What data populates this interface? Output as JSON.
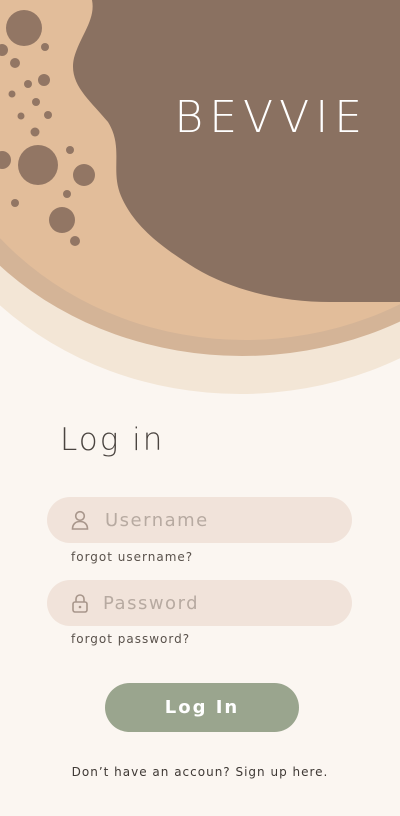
{
  "app": {
    "brand": "BEVVIE"
  },
  "login": {
    "title": "Log in",
    "username_placeholder": "Username",
    "forgot_username": "forgot username?",
    "password_placeholder": "Password",
    "forgot_password": "forgot password?",
    "submit_label": "Log In",
    "signup_text": "Don’t have an accoun? Sign up here."
  },
  "icons": {
    "username": "user-icon",
    "password": "lock-icon"
  },
  "colors": {
    "background": "#fbf6f1",
    "coffee": "#8a7161",
    "foam": "#e2bd9a",
    "cup_mid": "#d4b497",
    "cup_outer": "#f3e6d6",
    "bubbles": "#785f52",
    "field": "#f1e3da",
    "button": "#9aa58e"
  }
}
